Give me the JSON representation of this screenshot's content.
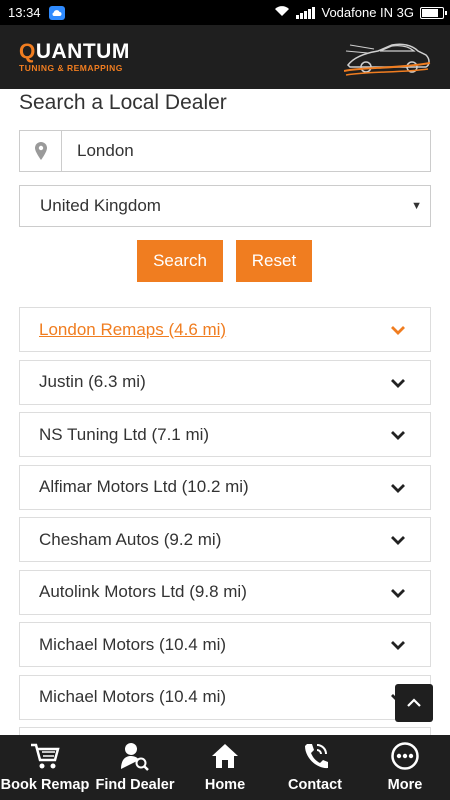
{
  "status_bar": {
    "time": "13:34",
    "carrier": "Vodafone IN 3G",
    "battery_level": 0.85
  },
  "header": {
    "logo_main": "UANTUM",
    "logo_q": "Q",
    "logo_sub": "TUNING & REMAPPING"
  },
  "page": {
    "title": "Search a Local Dealer"
  },
  "search": {
    "location_value": "London",
    "country_value": "United Kingdom",
    "search_label": "Search",
    "reset_label": "Reset"
  },
  "dealers": [
    {
      "label": "London Remaps (4.6 mi)",
      "active": true
    },
    {
      "label": "Justin (6.3 mi)"
    },
    {
      "label": "NS Tuning Ltd (7.1 mi)"
    },
    {
      "label": "Alfimar Motors Ltd (10.2 mi)"
    },
    {
      "label": "Chesham Autos (9.2 mi)"
    },
    {
      "label": "Autolink Motors Ltd (9.8 mi)"
    },
    {
      "label": "Michael Motors (10.4 mi)"
    },
    {
      "label": "Michael Motors (10.4 mi)"
    }
  ],
  "bottom_nav": [
    {
      "label": "Book Remap",
      "icon": "cart-icon"
    },
    {
      "label": "Find Dealer",
      "icon": "person-search-icon"
    },
    {
      "label": "Home",
      "icon": "home-icon"
    },
    {
      "label": "Contact",
      "icon": "phone-icon"
    },
    {
      "label": "More",
      "icon": "more-icon"
    }
  ],
  "colors": {
    "accent": "#f07d20",
    "header_bg": "#1f1f1f"
  }
}
